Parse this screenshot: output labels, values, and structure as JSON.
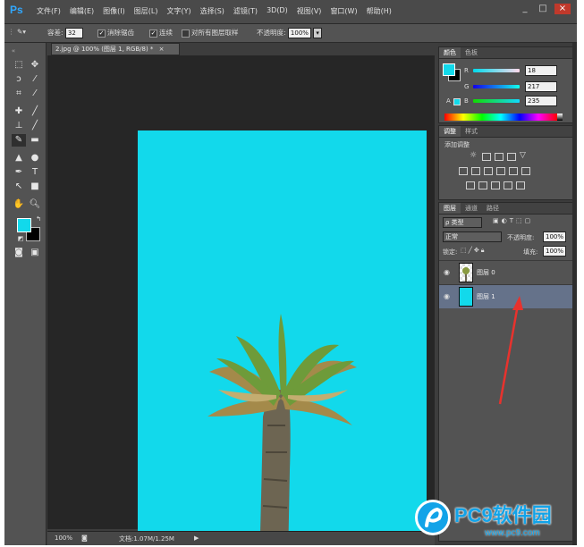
{
  "app": {
    "logo": "Ps"
  },
  "menu": [
    "文件(F)",
    "编辑(E)",
    "图像(I)",
    "图层(L)",
    "文字(Y)",
    "选择(S)",
    "滤镜(T)",
    "3D(D)",
    "视图(V)",
    "窗口(W)",
    "帮助(H)"
  ],
  "window_controls": {
    "min": "_",
    "max": "□",
    "close": "×"
  },
  "options": {
    "tolerance_label": "容差:",
    "tolerance_value": "32",
    "antialias_label": "消除锯齿",
    "contiguous_label": "连续",
    "sample_all_label": "对所有图层取样",
    "opacity_label": "不透明度:",
    "opacity_value": "100%"
  },
  "document": {
    "tab_label": "2.jpg @ 100% (图层 1, RGB/8) *",
    "tab_close": "×",
    "canvas_color": "#12d9eb"
  },
  "status": {
    "zoom": "100%",
    "doc_info": "文档:1.07M/1.25M"
  },
  "colors_panel": {
    "tabs": [
      "颜色",
      "色板"
    ],
    "r_label": "R",
    "r_value": "18",
    "g_label": "G",
    "g_value": "217",
    "b_label": "B",
    "b_value": "235",
    "fg_color": "#12d9eb"
  },
  "adjustments_panel": {
    "tabs": [
      "调整",
      "样式"
    ],
    "title": "添加调整"
  },
  "layers_panel": {
    "tabs": [
      "图层",
      "通道",
      "路径"
    ],
    "filter_label": "ρ 类型",
    "blend_mode": "正常",
    "opacity_label": "不透明度:",
    "opacity_value": "100%",
    "lock_label": "锁定:",
    "fill_label": "填充:",
    "fill_value": "100%",
    "layers": [
      {
        "name": "图层 0",
        "selected": false
      },
      {
        "name": "图层 1",
        "selected": true
      }
    ]
  },
  "watermark": {
    "text": "PC9软件园",
    "url": "www.pc9.com"
  }
}
